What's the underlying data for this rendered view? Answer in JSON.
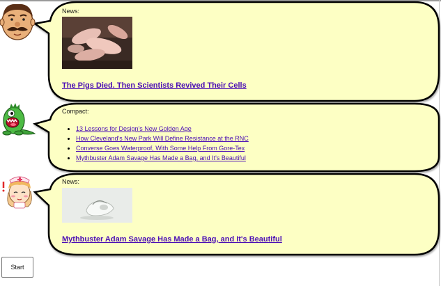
{
  "messages": [
    {
      "type_label": "News:",
      "headline": "The Pigs Died. Then Scientists Revived Their Cells",
      "image_alt": "piglets photo",
      "avatar": "mustached-man-avatar"
    },
    {
      "type_label": "Compact:",
      "avatar": "green-monster-avatar",
      "items": [
        "13 Lessons for Design's New Golden Age",
        "How Cleveland's New Park Will Define Resistance at the RNC",
        "Converse Goes Waterproof, With Some Help From Gore-Tex",
        "Mythbuster Adam Savage Has Made a Bag, and It's Beautiful"
      ]
    },
    {
      "type_label": "News:",
      "headline": "Mythbuster Adam Savage Has Made a Bag, and It's Beautiful",
      "image_alt": "clear bag photo",
      "avatar": "nurse-girl-avatar"
    }
  ],
  "start_button": {
    "label": "Start"
  },
  "colors": {
    "bubble_fill": "#fdffc4",
    "bubble_stroke": "#000000",
    "link": "#4a0db5"
  }
}
